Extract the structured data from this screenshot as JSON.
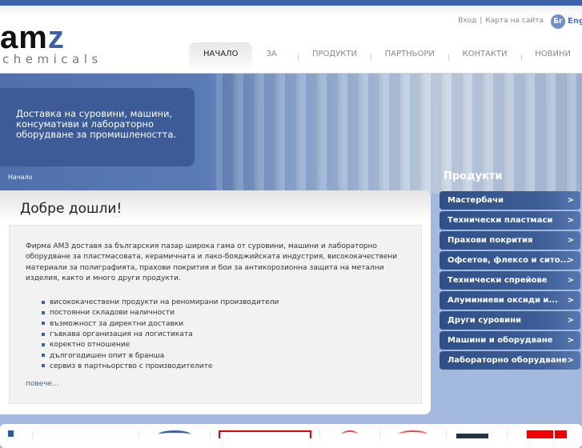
{
  "logo": {
    "main": "am",
    "accent": "z",
    "sub": "chemicals"
  },
  "toplinks": {
    "login": "Вход",
    "sep": "|",
    "sitemap": "Карта на сайта",
    "lang_bg": "Бг",
    "lang_en": "Eng"
  },
  "nav": [
    "НАЧАЛО",
    "ЗА НАС",
    "ПРОДУКТИ",
    "ПАРТНЬОРИ",
    "КОНТАКТИ",
    "НОВИНИ"
  ],
  "hero": {
    "tagline": "Доставка на суровини, машини, консумативи и лабораторно оборудване за промишлеността."
  },
  "breadcrumb": "Начало",
  "main": {
    "title": "Добре дошли!",
    "intro": "Фирма АМЗ доставя за българския пазар широка гама от суровини, машини и лабораторно оборудване за пластмасовата, керамичната и лако-бояджийската индустрия, висококачествени материали за полиграфията, прахови покрития и бои за антикорозионна защита на метални изделия, както и много други продукти.",
    "bullets": [
      "висококачествени продукти на реномирани производители",
      "постоянни складови наличности",
      "възможност за директни доставки",
      "гъвкава организация на логистиката",
      "коректно отношение",
      "дългогодишен опит в бранша",
      "сервиз в партньорство с производителите"
    ],
    "more": "повече..."
  },
  "sidebar": {
    "title": "Продукти",
    "chevron": ">",
    "items": [
      "Мастербачи",
      "Технически пластмаси",
      "Прахови покрития",
      "Офсетов, флексо и сито...",
      "Технически спрейове",
      "Алуминиеви оксиди и...",
      "Други суровини",
      "Машини и оборудване",
      "Лабораторно оборудване"
    ]
  },
  "colors": {
    "brand": "#3b62a8",
    "sidebar_item": "#2f4f87",
    "background": "#a3b9dd"
  }
}
